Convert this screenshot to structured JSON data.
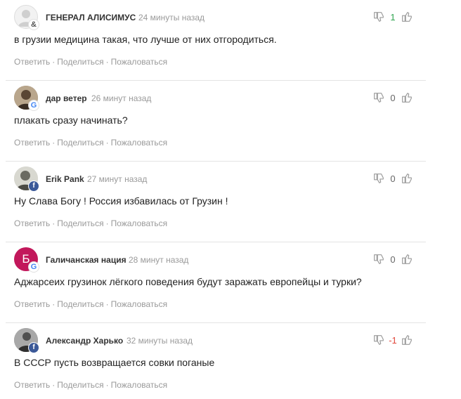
{
  "colors": {
    "positive": "#2ea44f",
    "negative": "#e0463a",
    "muted": "#9a9a9a"
  },
  "actions": {
    "reply": "Ответить",
    "share": "Поделиться",
    "report": "Пожаловаться",
    "separator": "·"
  },
  "comments": [
    {
      "author": "ГЕНЕРАЛ АЛИСИМУС",
      "time": "24 минуты назад",
      "text": "в грузии медицина такая, что лучше от них отгородиться.",
      "rating": "1",
      "avatar": "default-user-icon",
      "provider_icon": "ampersand-icon",
      "provider_glyph": "&"
    },
    {
      "author": "дар ветер",
      "time": "26 минут назад",
      "text": "плакать сразу начинать?",
      "rating": "0",
      "avatar": "user-photo",
      "provider_icon": "google-icon",
      "provider_glyph": "G"
    },
    {
      "author": "Erik Pank",
      "time": "27 минут назад",
      "text": "Ну Слава Богу ! Россия избавилась от Грузин !",
      "rating": "0",
      "avatar": "user-photo",
      "provider_icon": "facebook-icon",
      "provider_glyph": "f"
    },
    {
      "author": "Галичанская нация",
      "time": "28 минут назад",
      "text": "Аджарсеих грузинок лёгкого поведения будут заражать европейцы и турки?",
      "rating": "0",
      "avatar": "letter-avatar",
      "avatar_letter": "Б",
      "avatar_color": "#c2185b",
      "provider_icon": "google-icon",
      "provider_glyph": "G"
    },
    {
      "author": "Александр Харько",
      "time": "32 минуты назад",
      "text": "В СССР пусть возвращается совки поганые",
      "rating": "-1",
      "avatar": "user-photo",
      "provider_icon": "facebook-icon",
      "provider_glyph": "f"
    }
  ]
}
